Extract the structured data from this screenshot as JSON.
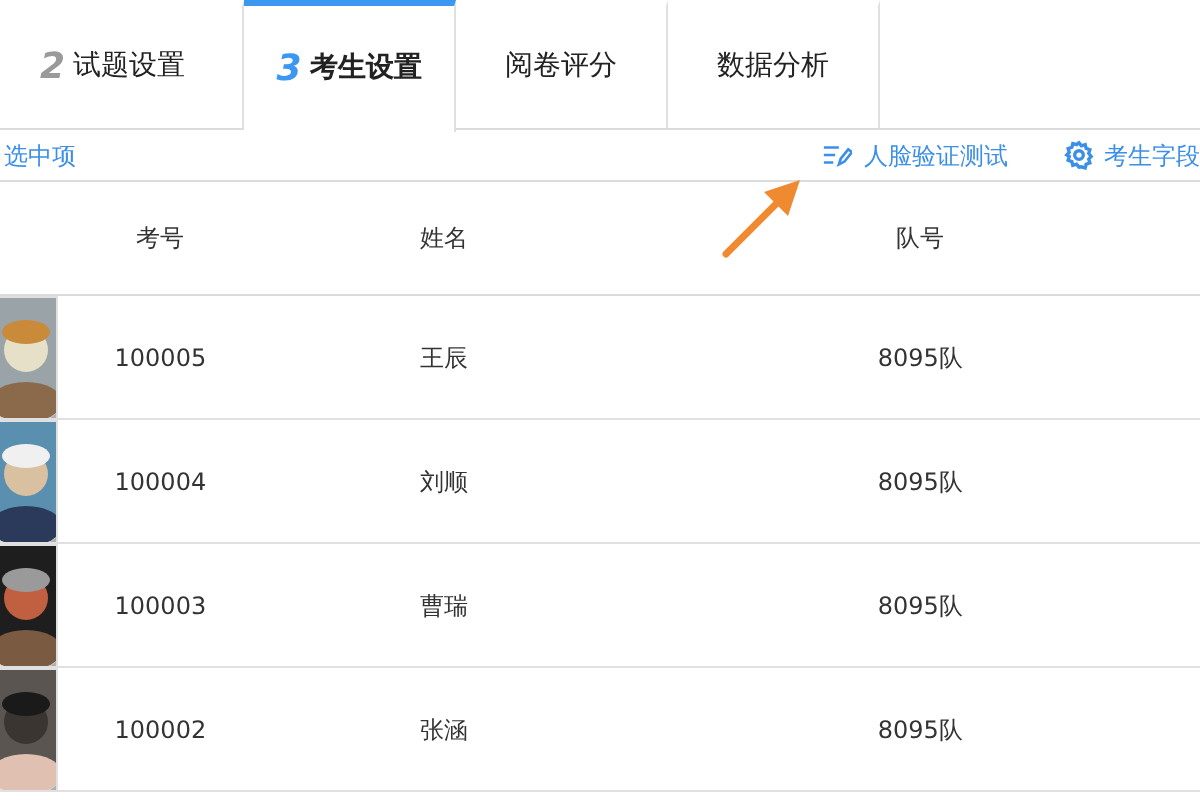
{
  "tabs": [
    {
      "number": "2",
      "label": "试题设置",
      "selected": false
    },
    {
      "number": "3",
      "label": "考生设置",
      "selected": true
    },
    {
      "label": "阅卷评分",
      "selected": false
    },
    {
      "label": "数据分析",
      "selected": false
    }
  ],
  "toolbar": {
    "left_link": "选中项",
    "face_test": "人脸验证测试",
    "fields": "考生字段"
  },
  "table": {
    "columns": [
      "考号",
      "姓名",
      "队号"
    ],
    "rows": [
      {
        "id": "100005",
        "name": "王辰",
        "team": "8095队"
      },
      {
        "id": "100004",
        "name": "刘顺",
        "team": "8095队"
      },
      {
        "id": "100003",
        "name": "曹瑞",
        "team": "8095队"
      },
      {
        "id": "100002",
        "name": "张涵",
        "team": "8095队"
      }
    ]
  }
}
